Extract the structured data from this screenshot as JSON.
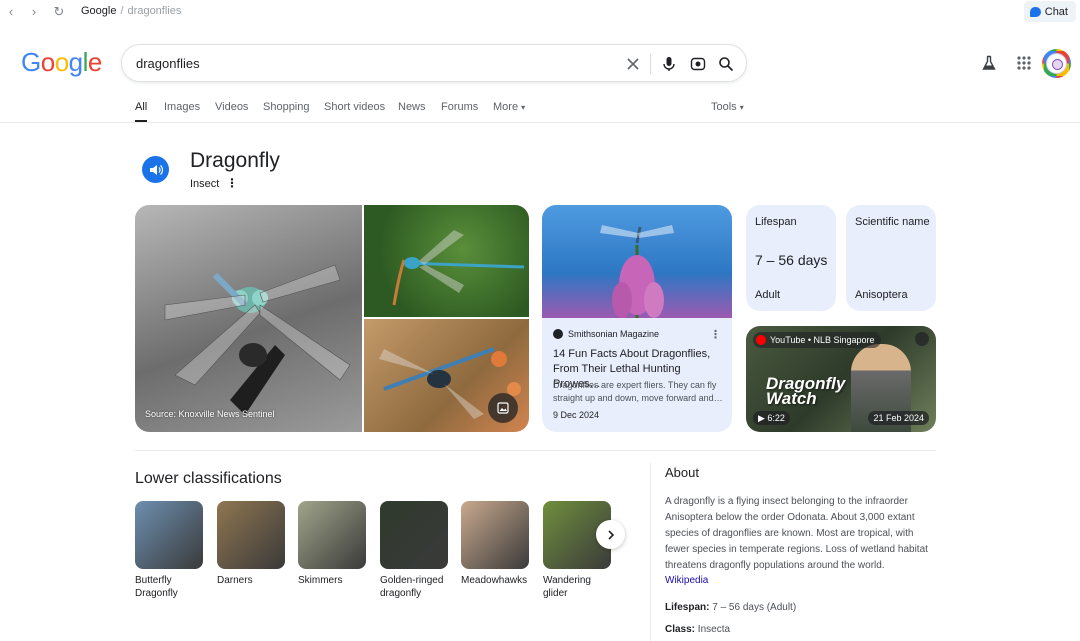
{
  "browser": {
    "breadcrumb_root": "Google",
    "breadcrumb_sep": "/",
    "breadcrumb_query": "dragonflies",
    "chat_label": "Chat"
  },
  "search": {
    "query": "dragonflies"
  },
  "tabs": [
    {
      "label": "All"
    },
    {
      "label": "Images"
    },
    {
      "label": "Videos"
    },
    {
      "label": "Shopping"
    },
    {
      "label": "Short videos"
    },
    {
      "label": "News"
    },
    {
      "label": "Forums"
    },
    {
      "label": "More"
    }
  ],
  "tools_label": "Tools",
  "entity": {
    "title": "Dragonfly",
    "subtitle": "Insect"
  },
  "images": {
    "source_caption": "Source: Knoxville News Sentinel"
  },
  "article": {
    "source": "Smithsonian Magazine",
    "title": "14 Fun Facts About Dragonflies, From Their Lethal Hunting Prowes…",
    "snippet": "Dragonflies are expert fliers. They can fly straight up and down, move forward and…",
    "date": "9 Dec 2024"
  },
  "facts": [
    {
      "label": "Lifespan",
      "value": "7 – 56 days",
      "sub": "Adult"
    },
    {
      "label": "Scientific name",
      "value": "",
      "sub": "Anisoptera"
    }
  ],
  "video": {
    "channel": "YouTube • NLB Singapore",
    "title_line1": "Dragonfly",
    "title_line2": "Watch",
    "duration": "▶ 6:22",
    "date": "21 Feb 2024"
  },
  "lower_classifications": {
    "title": "Lower classifications",
    "items": [
      {
        "name": "Butterfly Dragonfly",
        "color": "#6d8fb0"
      },
      {
        "name": "Darners",
        "color": "#8f7650"
      },
      {
        "name": "Skimmers",
        "color": "#a0a58a"
      },
      {
        "name": "Golden-ringed dragonfly",
        "color": "#2f3a2c"
      },
      {
        "name": "Meadowhawks",
        "color": "#c9a98e"
      },
      {
        "name": "Wandering glider",
        "color": "#6f8f3c"
      }
    ]
  },
  "about": {
    "title": "About",
    "text": "A dragonfly is a flying insect belonging to the infraorder Anisoptera below the order Odonata. About 3,000 extant species of dragonflies are known. Most are tropical, with fewer species in temperate regions. Loss of wetland habitat threatens dragonfly populations around the world.",
    "link": "Wikipedia",
    "lifespan_key": "Lifespan:",
    "lifespan_val": "7 – 56 days (Adult)",
    "class_key": "Class:",
    "class_val": "Insecta"
  },
  "colors": {
    "accent": "#1a73e8",
    "link": "#1a0dab",
    "card_bg": "#e8eefb"
  }
}
